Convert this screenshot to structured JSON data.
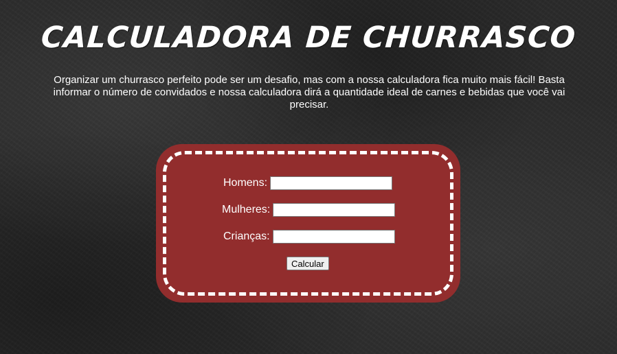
{
  "header": {
    "title": "CALCULADORA DE CHURRASCO",
    "intro": "Organizar um churrasco perfeito pode ser um desafio, mas com a nossa calculadora fica muito mais fácil! Basta informar o número de convidados e nossa calculadora dirá a quantidade ideal de carnes e bebidas que você vai precisar."
  },
  "form": {
    "fields": [
      {
        "label": "Homens:",
        "value": ""
      },
      {
        "label": "Mulheres:",
        "value": ""
      },
      {
        "label": "Crianças:",
        "value": ""
      }
    ],
    "submit_label": "Calcular"
  },
  "colors": {
    "background": "#2b2b2b",
    "card": "#922d2d",
    "card_border": "#ffffff",
    "text": "#ffffff"
  }
}
